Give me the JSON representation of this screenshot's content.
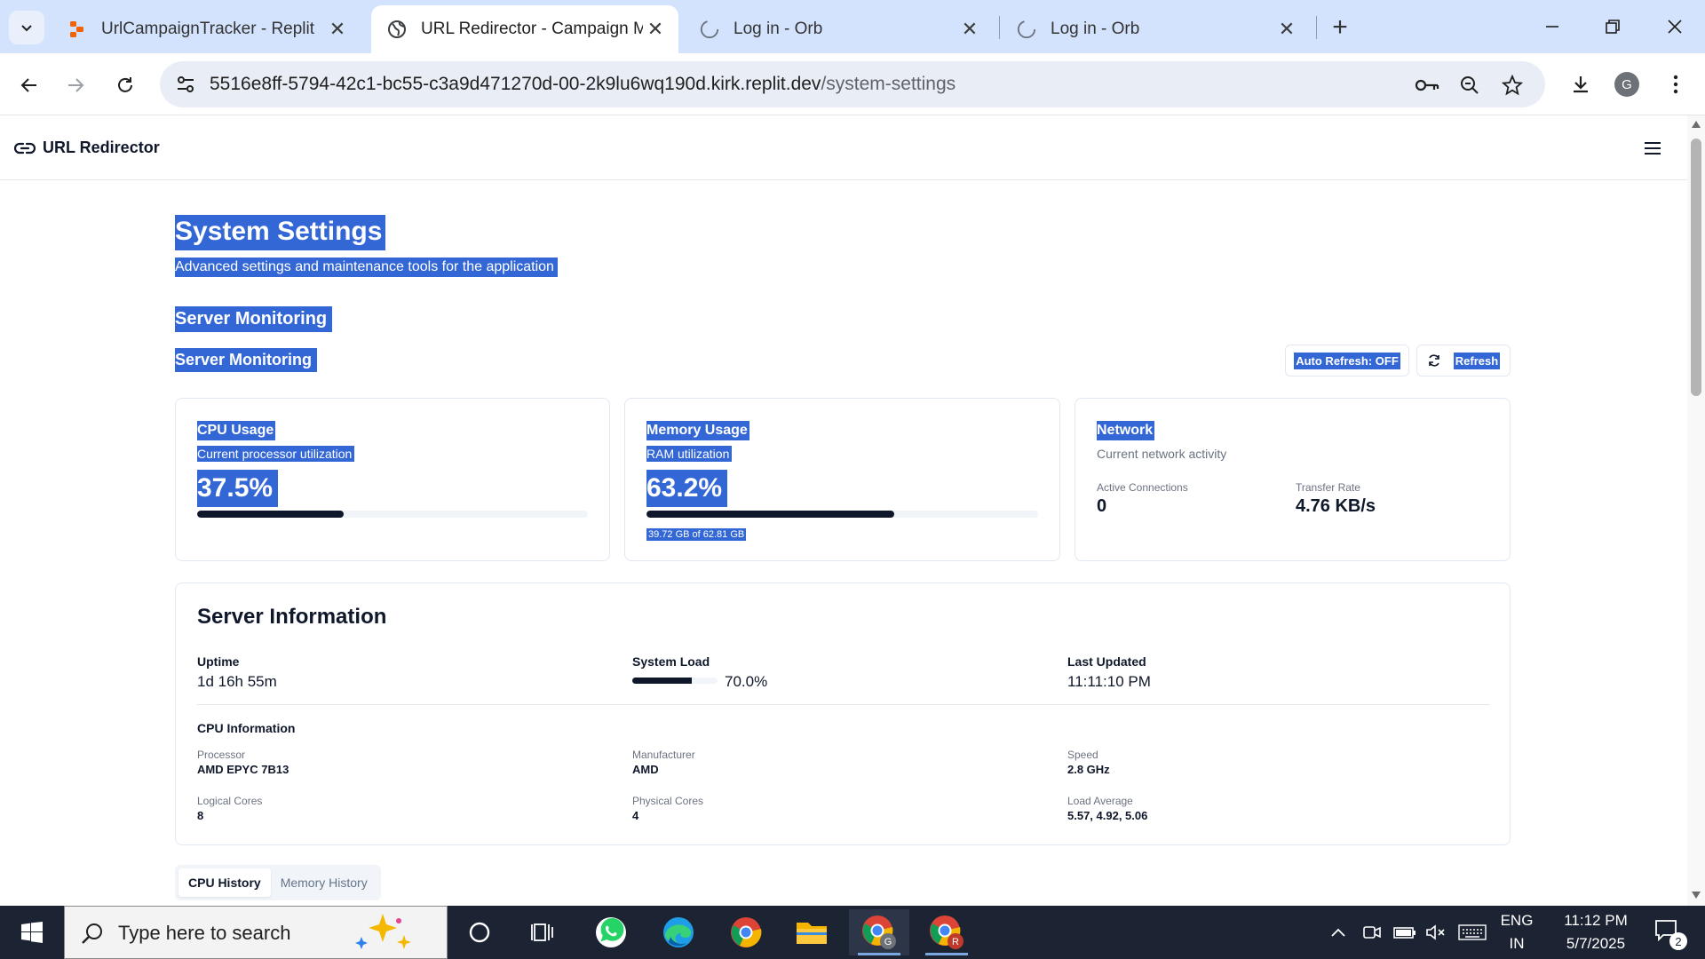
{
  "browser": {
    "tabs": [
      {
        "title": "UrlCampaignTracker - Replit",
        "active": false
      },
      {
        "title": "URL Redirector - Campaign Mar",
        "active": true
      },
      {
        "title": "Log in - Orb",
        "active": false
      },
      {
        "title": "Log in - Orb",
        "active": false
      }
    ],
    "url_host": "5516e8ff-5794-42c1-bc55-c3a9d471270d-00-2k9lu6wq190d.kirk.replit.dev",
    "url_path": "/system-settings",
    "profile_initial": "G"
  },
  "app": {
    "brand": "URL Redirector"
  },
  "page": {
    "title": "System Settings",
    "subtitle": "Advanced settings and maintenance tools for the application",
    "section_heading": "Server Monitoring",
    "monitor_heading": "Server Monitoring",
    "auto_refresh_label": "Auto Refresh: OFF",
    "refresh_label": "Refresh"
  },
  "cards": {
    "cpu": {
      "title": "CPU Usage",
      "desc": "Current processor utilization",
      "value": "37.5%",
      "fraction": 0.375
    },
    "memory": {
      "title": "Memory Usage",
      "desc": "RAM utilization",
      "value": "63.2%",
      "fraction": 0.632,
      "note": "39.72 GB of 62.81 GB"
    },
    "network": {
      "title": "Network",
      "desc": "Current network activity",
      "connections_label": "Active Connections",
      "connections_value": "0",
      "rate_label": "Transfer Rate",
      "rate_value": "4.76 KB/s"
    }
  },
  "server_info": {
    "title": "Server Information",
    "uptime_label": "Uptime",
    "uptime_value": "1d 16h 55m",
    "load_label": "System Load",
    "load_value": "70.0%",
    "load_fraction": 0.7,
    "updated_label": "Last Updated",
    "updated_value": "11:11:10 PM",
    "cpu_info_heading": "CPU Information",
    "processor_label": "Processor",
    "processor_value": "AMD EPYC 7B13",
    "manufacturer_label": "Manufacturer",
    "manufacturer_value": "AMD",
    "speed_label": "Speed",
    "speed_value": "2.8 GHz",
    "logical_label": "Logical Cores",
    "logical_value": "8",
    "physical_label": "Physical Cores",
    "physical_value": "4",
    "loadavg_label": "Load Average",
    "loadavg_value": "5.57, 4.92, 5.06"
  },
  "history_tabs": [
    {
      "label": "CPU History",
      "active": true
    },
    {
      "label": "Memory History",
      "active": false
    }
  ],
  "taskbar": {
    "search_placeholder": "Type here to search",
    "lang_top": "ENG",
    "lang_bottom": "IN",
    "time": "11:12 PM",
    "date": "5/7/2025",
    "notification_count": "2"
  },
  "colors": {
    "selection": "#3367d6",
    "progress_fill": "#0f172a",
    "tabstrip": "#d3e3fd",
    "taskbar": "#1c2434"
  }
}
